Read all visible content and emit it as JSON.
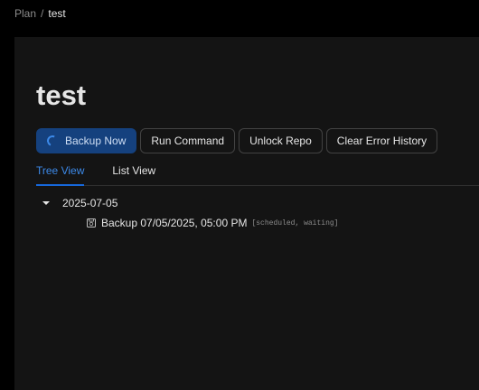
{
  "breadcrumb": {
    "parent": "Plan",
    "separator": "/",
    "current": "test"
  },
  "page": {
    "title": "test"
  },
  "actions": {
    "backup_now": "Backup Now",
    "run_command": "Run Command",
    "unlock_repo": "Unlock Repo",
    "clear_error_history": "Clear Error History"
  },
  "tabs": [
    {
      "label": "Tree View",
      "active": true
    },
    {
      "label": "List View",
      "active": false
    }
  ],
  "tree": {
    "group_label": "2025-07-05",
    "entries": [
      {
        "label": "Backup 07/05/2025, 05:00 PM",
        "status": "[scheduled, waiting]",
        "icon": "snapshot-icon"
      }
    ]
  },
  "colors": {
    "primary": "#15417e",
    "accent": "#3c89e8",
    "panel_bg": "#141414",
    "page_bg": "#000000"
  }
}
